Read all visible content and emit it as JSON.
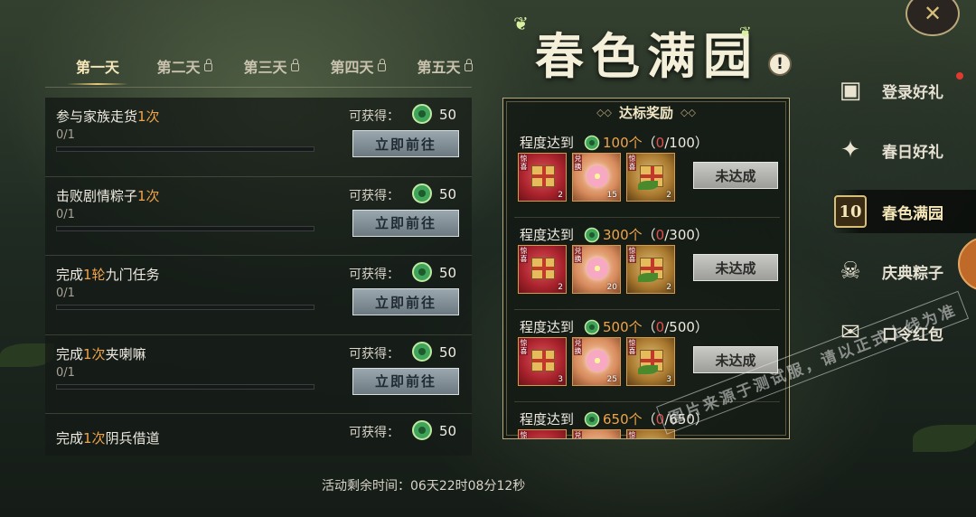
{
  "tabs": [
    {
      "label": "第一天",
      "active": true,
      "locked": false
    },
    {
      "label": "第二天",
      "active": false,
      "locked": true
    },
    {
      "label": "第三天",
      "active": false,
      "locked": true
    },
    {
      "label": "第四天",
      "active": false,
      "locked": true
    },
    {
      "label": "第五天",
      "active": false,
      "locked": true
    }
  ],
  "tasks": [
    {
      "title_pre": "参与家族走货",
      "title_hl": "1次",
      "title_post": "",
      "progress": "0/1",
      "progress_fraction": 0,
      "reward_label": "可获得：",
      "reward_amount": "50",
      "button": "立即前往"
    },
    {
      "title_pre": "击败剧情粽子",
      "title_hl": "1次",
      "title_post": "",
      "progress": "0/1",
      "progress_fraction": 0,
      "reward_label": "可获得：",
      "reward_amount": "50",
      "button": "立即前往"
    },
    {
      "title_pre": "完成",
      "title_hl": "1轮",
      "title_post": "九门任务",
      "progress": "0/1",
      "progress_fraction": 0,
      "reward_label": "可获得：",
      "reward_amount": "50",
      "button": "立即前往"
    },
    {
      "title_pre": "完成",
      "title_hl": "1次",
      "title_post": "夹喇嘛",
      "progress": "0/1",
      "progress_fraction": 0,
      "reward_label": "可获得：",
      "reward_amount": "50",
      "button": "立即前往"
    },
    {
      "title_pre": "完成",
      "title_hl": "1次",
      "title_post": "阴兵借道",
      "reward_label": "可获得：",
      "reward_amount": "50"
    }
  ],
  "timer": "活动剩余时间：06天22时08分12秒",
  "title": "春色满园",
  "info_icon": "!",
  "reward_panel": {
    "heading": "达标奖励",
    "tiers": [
      {
        "label": "程度达到",
        "target": "100个",
        "paren_open": "（",
        "current": "0",
        "total": "/100）",
        "items": [
          {
            "style": "red",
            "tag": "惊喜",
            "count": "2"
          },
          {
            "style": "pink",
            "tag": "兑换",
            "count": "15"
          },
          {
            "style": "gold",
            "tag": "惊喜",
            "count": "2"
          }
        ],
        "button": "未达成"
      },
      {
        "label": "程度达到",
        "target": "300个",
        "paren_open": "（",
        "current": "0",
        "total": "/300）",
        "items": [
          {
            "style": "red",
            "tag": "惊喜",
            "count": "2"
          },
          {
            "style": "pink",
            "tag": "兑换",
            "count": "20"
          },
          {
            "style": "gold",
            "tag": "惊喜",
            "count": "2"
          }
        ],
        "button": "未达成"
      },
      {
        "label": "程度达到",
        "target": "500个",
        "paren_open": "（",
        "current": "0",
        "total": "/500）",
        "items": [
          {
            "style": "red",
            "tag": "惊喜",
            "count": "3"
          },
          {
            "style": "pink",
            "tag": "兑换",
            "count": "25"
          },
          {
            "style": "gold",
            "tag": "惊喜",
            "count": "3"
          }
        ],
        "button": "未达成"
      },
      {
        "label": "程度达到",
        "target": "650个",
        "paren_open": "（",
        "current": "0",
        "total": "/650）",
        "items": [
          {
            "style": "red",
            "tag": "惊喜",
            "count": ""
          },
          {
            "style": "pink",
            "tag": "兑换",
            "count": ""
          },
          {
            "style": "gold",
            "tag": "惊喜",
            "count": ""
          }
        ],
        "button": ""
      }
    ]
  },
  "side_menu": [
    {
      "label": "登录好礼",
      "icon": "calendar-icon",
      "glyph": "▣",
      "active": false,
      "badge": true
    },
    {
      "label": "春日好礼",
      "icon": "sparkle-hand-icon",
      "glyph": "✦",
      "active": false,
      "badge": false
    },
    {
      "label": "春色满园",
      "icon": "ten-gift-icon",
      "glyph": "10",
      "active": true,
      "badge": false
    },
    {
      "label": "庆典粽子",
      "icon": "mask-icon",
      "glyph": "☠",
      "active": false,
      "badge": false
    },
    {
      "label": "口令红包",
      "icon": "red-envelope-icon",
      "glyph": "✉",
      "active": false,
      "badge": false
    }
  ],
  "watermark": "图片来源于测试服，请以正式上线为准",
  "colors": {
    "highlight": "#f0a44a",
    "current_zero": "#e05050",
    "badge": "#e03a2e"
  }
}
